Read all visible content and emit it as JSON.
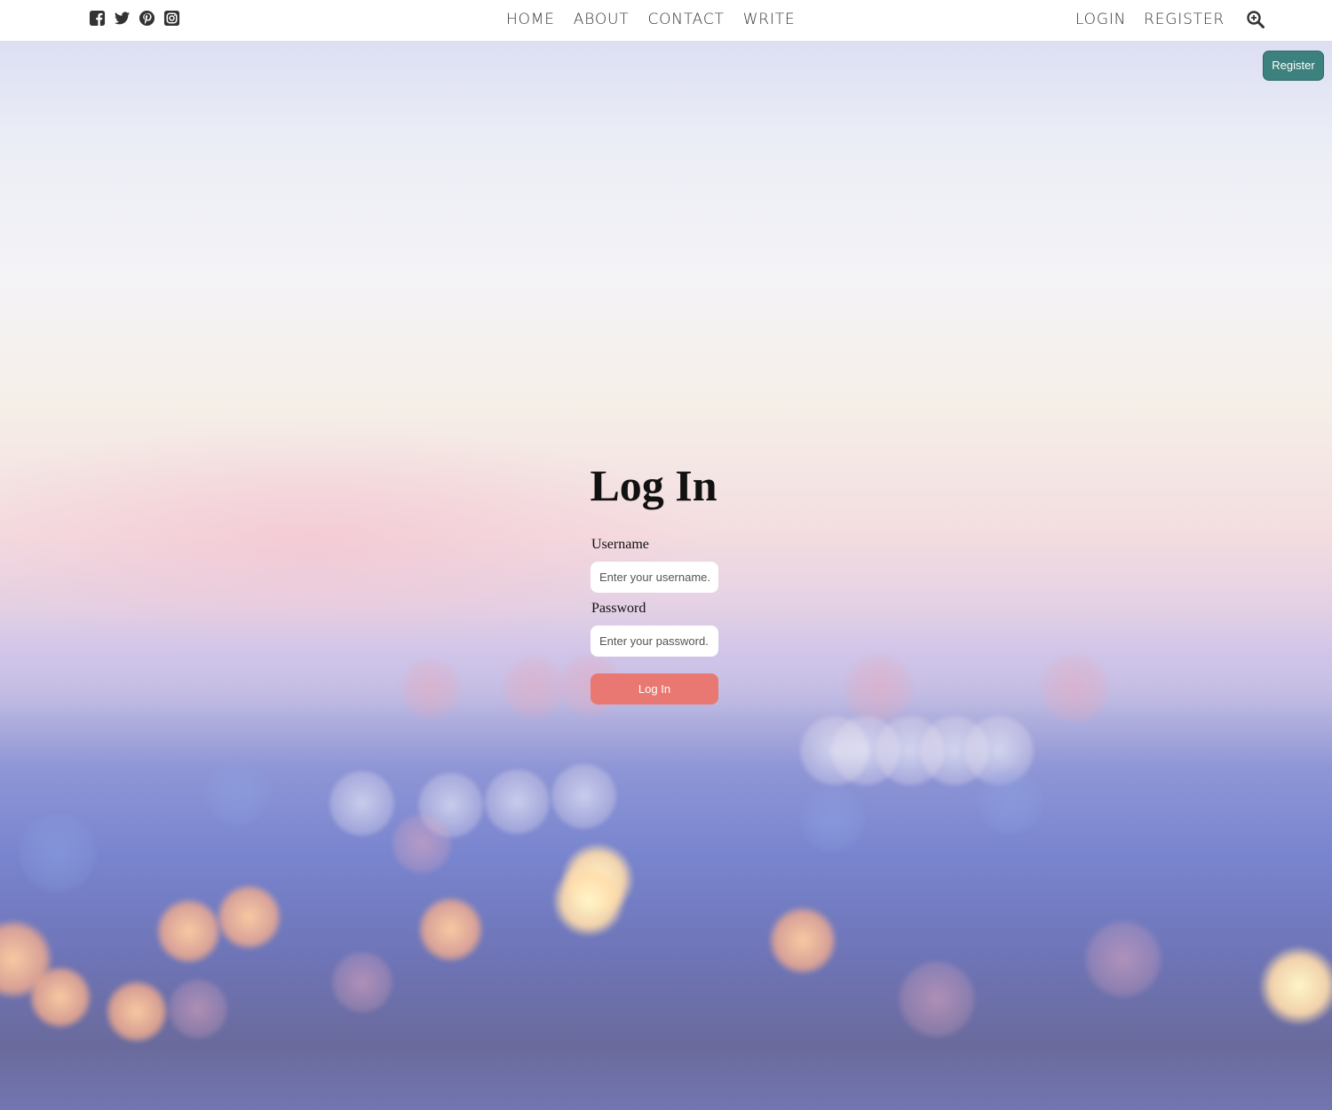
{
  "social": [
    {
      "icon": "facebook-square-icon"
    },
    {
      "icon": "twitter-icon"
    },
    {
      "icon": "pinterest-icon"
    },
    {
      "icon": "instagram-icon"
    }
  ],
  "nav": {
    "items": [
      "HOME",
      "ABOUT",
      "CONTACT",
      "WRITE"
    ]
  },
  "auth": {
    "login": "LOGIN",
    "register": "REGISTER",
    "search_icon": "search-plus-icon"
  },
  "register_button": "Register",
  "login_form": {
    "title": "Log In",
    "username_label": "Username",
    "username_placeholder": "Enter your username...",
    "password_label": "Password",
    "password_placeholder": "Enter your password...",
    "submit": "Log In"
  },
  "colors": {
    "register_button": "#3d817e",
    "login_button": "#ea7872",
    "nav_text": "#333333"
  }
}
